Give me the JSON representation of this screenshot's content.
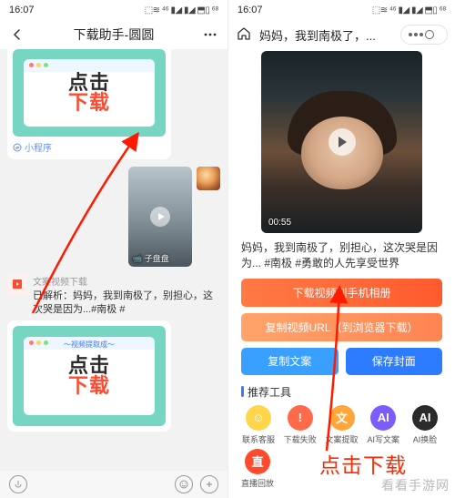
{
  "status": {
    "time": "16:07",
    "icons": "⬚≋ ⁴⁶ ▮◢ ▮◢ ⬒▯  ⁶⁸"
  },
  "left": {
    "title": "下载助手-圆圆",
    "promo_line1": "点击",
    "promo_line2": "下载",
    "card_foot": "小程序",
    "ext_banner": "～视频提取成～",
    "thumb_caption": "子盘盘",
    "parse_source": "文案视频下载",
    "parse_text": "已解析：妈妈，我到南极了，别担心，这次哭是因为...#南极 #",
    "arrow_annotation": "指向箭头"
  },
  "right": {
    "title": "妈妈，我到南极了，...",
    "duration": "00:55",
    "caption": "妈妈，我到南极了，别担心，这次哭是因为... #南极 #勇敢的人先享受世界",
    "btn_download": "下载视频到手机相册",
    "btn_copy": "复制视频URL（到浏览器下载）",
    "btn_copytxt": "复制文案",
    "btn_savecover": "保存封面",
    "tools_header": "推荐工具",
    "tools": [
      {
        "label": "联系客服",
        "bg": "#ffd54a",
        "glyph": "☺"
      },
      {
        "label": "下载失败",
        "bg": "#ff6b4a",
        "glyph": "!"
      },
      {
        "label": "文案提取",
        "bg": "#ffa63a",
        "glyph": "文"
      },
      {
        "label": "AI写文案",
        "bg": "#7b5cff",
        "glyph": "AI"
      },
      {
        "label": "AI换脸",
        "bg": "#2b2b2b",
        "glyph": "AI"
      }
    ],
    "tool_live": {
      "label": "直播回放",
      "bg": "#ff4a2e",
      "glyph": "直"
    },
    "overlay_text": "点击下载"
  },
  "watermark": "看看手游网"
}
